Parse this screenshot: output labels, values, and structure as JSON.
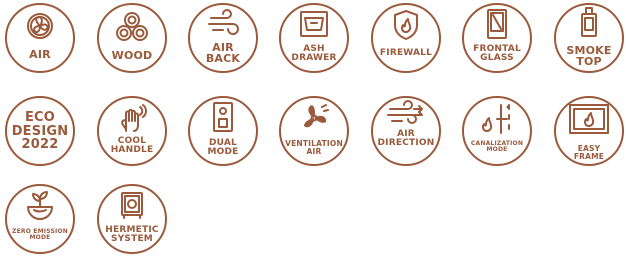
{
  "colors": {
    "brand": "#9a5a3b",
    "background": "#ffffff"
  },
  "badges": [
    {
      "id": "air",
      "icon": "fan-icon",
      "label": "AIR"
    },
    {
      "id": "wood",
      "icon": "wood-logs-icon",
      "label": "WOOD"
    },
    {
      "id": "air-back",
      "icon": "air-flow-icon",
      "label": "AIR\nBACK"
    },
    {
      "id": "ash-drawer",
      "icon": "ash-drawer-icon",
      "label": "ASH\nDRAWER"
    },
    {
      "id": "firewall",
      "icon": "shield-flame-icon",
      "label": "FIREWALL"
    },
    {
      "id": "frontal-glass",
      "icon": "stove-door-icon",
      "label": "FRONTAL\nGLASS"
    },
    {
      "id": "smoke-top",
      "icon": "smoke-outlet-icon",
      "label": "SMOKE\nTOP"
    },
    {
      "id": "eco-design",
      "icon": "",
      "label": "ECO\nDESIGN\n2022"
    },
    {
      "id": "cool-handle",
      "icon": "hand-icon",
      "label": "COOL\nHANDLE"
    },
    {
      "id": "dual-mode",
      "icon": "dual-mode-icon",
      "label": "DUAL\nMODE"
    },
    {
      "id": "ventilation-air",
      "icon": "ventilation-fan-icon",
      "label": "VENTILATION\nAIR"
    },
    {
      "id": "air-direction",
      "icon": "air-direction-icon",
      "label": "AIR\nDIRECTION"
    },
    {
      "id": "canalization-mode",
      "icon": "canalization-icon",
      "label": "CANALIZATION\nMODE"
    },
    {
      "id": "easy-frame",
      "icon": "frame-flame-icon",
      "label": "EASY\nFRAME"
    },
    {
      "id": "zero-emission",
      "icon": "leaf-globe-icon",
      "label": "ZERO EMISSION\nMODE"
    },
    {
      "id": "hermetic-system",
      "icon": "safe-icon",
      "label": "HERMETIC\nSYSTEM"
    }
  ]
}
